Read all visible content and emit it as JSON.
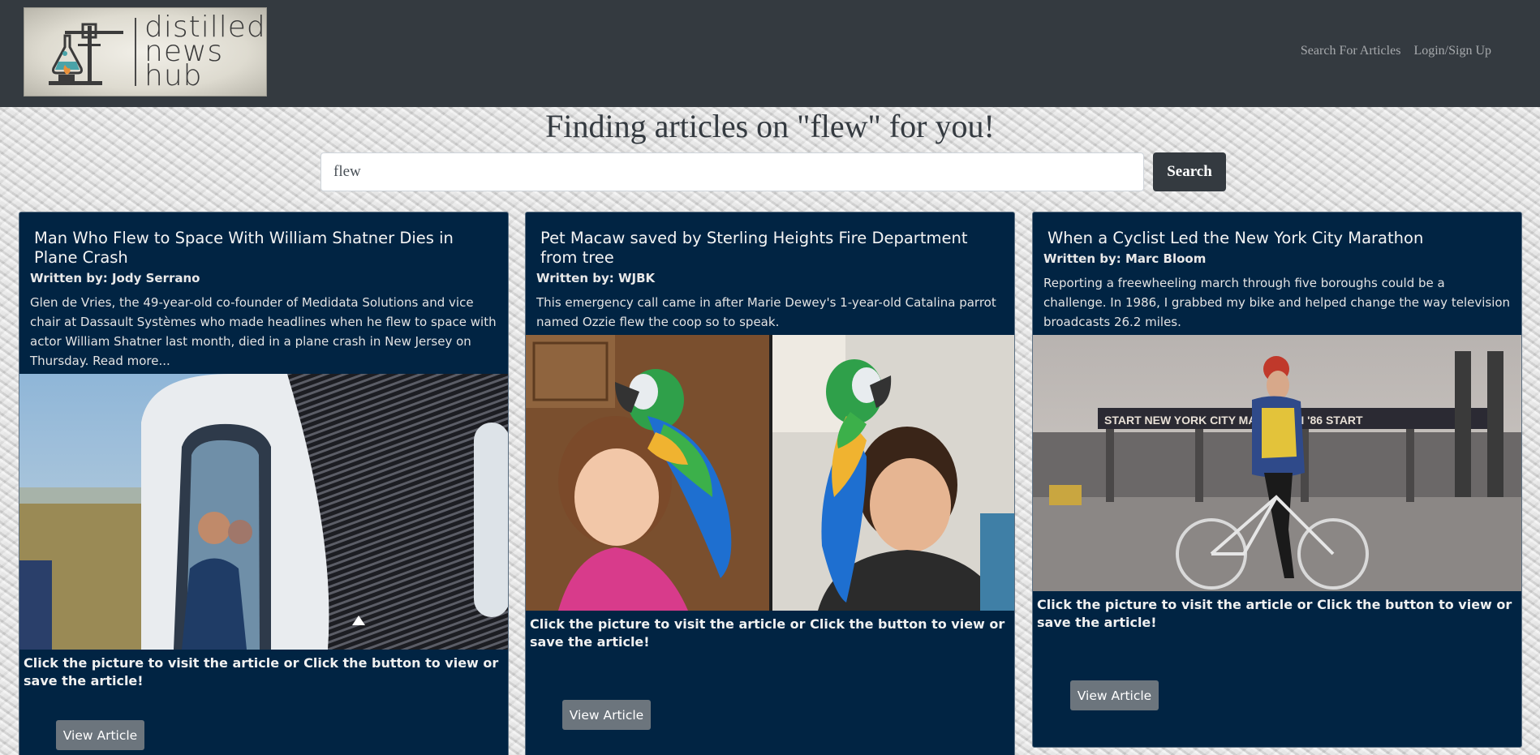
{
  "navbar": {
    "logo_words": [
      "distilled",
      "news",
      "hub"
    ],
    "links": [
      "Search For Articles",
      "Login/Sign Up"
    ]
  },
  "heading": "Finding articles on \"flew\" for you!",
  "search": {
    "value": "flew",
    "button_label": "Search"
  },
  "cards": [
    {
      "title": "Man Who Flew to Space With William Shatner Dies in Plane Crash",
      "author": "Written by: Jody Serrano",
      "description": "Glen de Vries, the 49-year-old co-founder of Medidata Solutions and vice chair at Dassault Systèmes who made headlines when he flew to space with actor William Shatner last month, died in a plane crash in New Jersey on Thursday. Read more...",
      "caption": "Click the picture to visit the article or Click the button to view or save the article!",
      "button_label": "View Article"
    },
    {
      "title": "Pet Macaw saved by Sterling Heights Fire Department from tree",
      "author": "Written by: WJBK",
      "description": "This emergency call came in after Marie Dewey's 1-year-old Catalina parrot named Ozzie flew the coop so to speak.",
      "caption": "Click the picture to visit the article or Click the button to view or save the article!",
      "button_label": "View Article"
    },
    {
      "title": "When a Cyclist Led the New York City Marathon",
      "author": "Written by: Marc Bloom",
      "description": "Reporting a freewheeling march through five boroughs could be a challenge. In 1986, I grabbed my bike and helped change the way television broadcasts 26.2 miles.",
      "caption": "Click the picture to visit the article or Click the button to view or save the article!",
      "button_label": "View Article",
      "image_banner": "START NEW YORK CITY MARATHON '86 START"
    }
  ]
}
